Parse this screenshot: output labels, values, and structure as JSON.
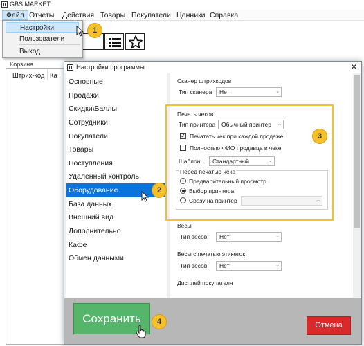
{
  "main": {
    "title": "GBS.MARKET",
    "menu": [
      "Файл",
      "Отчеты",
      "Действия",
      "Товары",
      "Покупатели",
      "Ценники",
      "Справка"
    ],
    "file_dropdown": [
      "Настройки",
      "Пользователи",
      "Выход"
    ],
    "basket_label": "Корзина",
    "columns": [
      "Штрих-код",
      "Ка"
    ]
  },
  "dialog": {
    "title": "Настройки программы",
    "close_glyph": "✕",
    "nav": [
      "Основные",
      "Продажи",
      "Скидки\\Баллы",
      "Сотрудники",
      "Покупатели",
      "Товары",
      "Поступления",
      "Удаленный контроль",
      "Оборудование",
      "База данных",
      "Внешний вид",
      "Дополнительно",
      "Кафе",
      "Обмен данными"
    ],
    "nav_selected": "Оборудование",
    "scanner": {
      "title": "Сканер штрихкодов",
      "type_label": "Тип сканера",
      "type_value": "Нет"
    },
    "printing": {
      "title": "Печать чеков",
      "printer_label": "Тип принтера",
      "printer_value": "Обычный принтер",
      "cb_print_each": "Печатать чек при каждой продаже",
      "cb_print_each_checked": true,
      "cb_full_name": "Полностью ФИО продавца в чеке",
      "cb_full_name_checked": false,
      "template_label": "Шаблон",
      "template_value": "Стандартный",
      "before_print_title": "Перед печатью чека",
      "radio_preview": "Предварительный просмотр",
      "radio_select_printer": "Выбор принтера",
      "radio_direct": "Сразу на принтер",
      "radio_selected": "Выбор принтера"
    },
    "scales": {
      "title": "Весы",
      "type_label": "Тип весов",
      "type_value": "Нет"
    },
    "label_scales": {
      "title": "Весы с печатью этикеток",
      "type_label": "Тип весов",
      "type_value": "Нет"
    },
    "customer_display": {
      "title": "Дисплей покупателя"
    },
    "save_label": "Сохранить",
    "cancel_label": "Отмена"
  },
  "badges": [
    "1",
    "2",
    "3",
    "4"
  ],
  "colors": {
    "selection": "#0a74da",
    "save": "#55b56b",
    "cancel": "#d8292b",
    "highlight": "#f2c230",
    "badge": "#f5c02a"
  }
}
